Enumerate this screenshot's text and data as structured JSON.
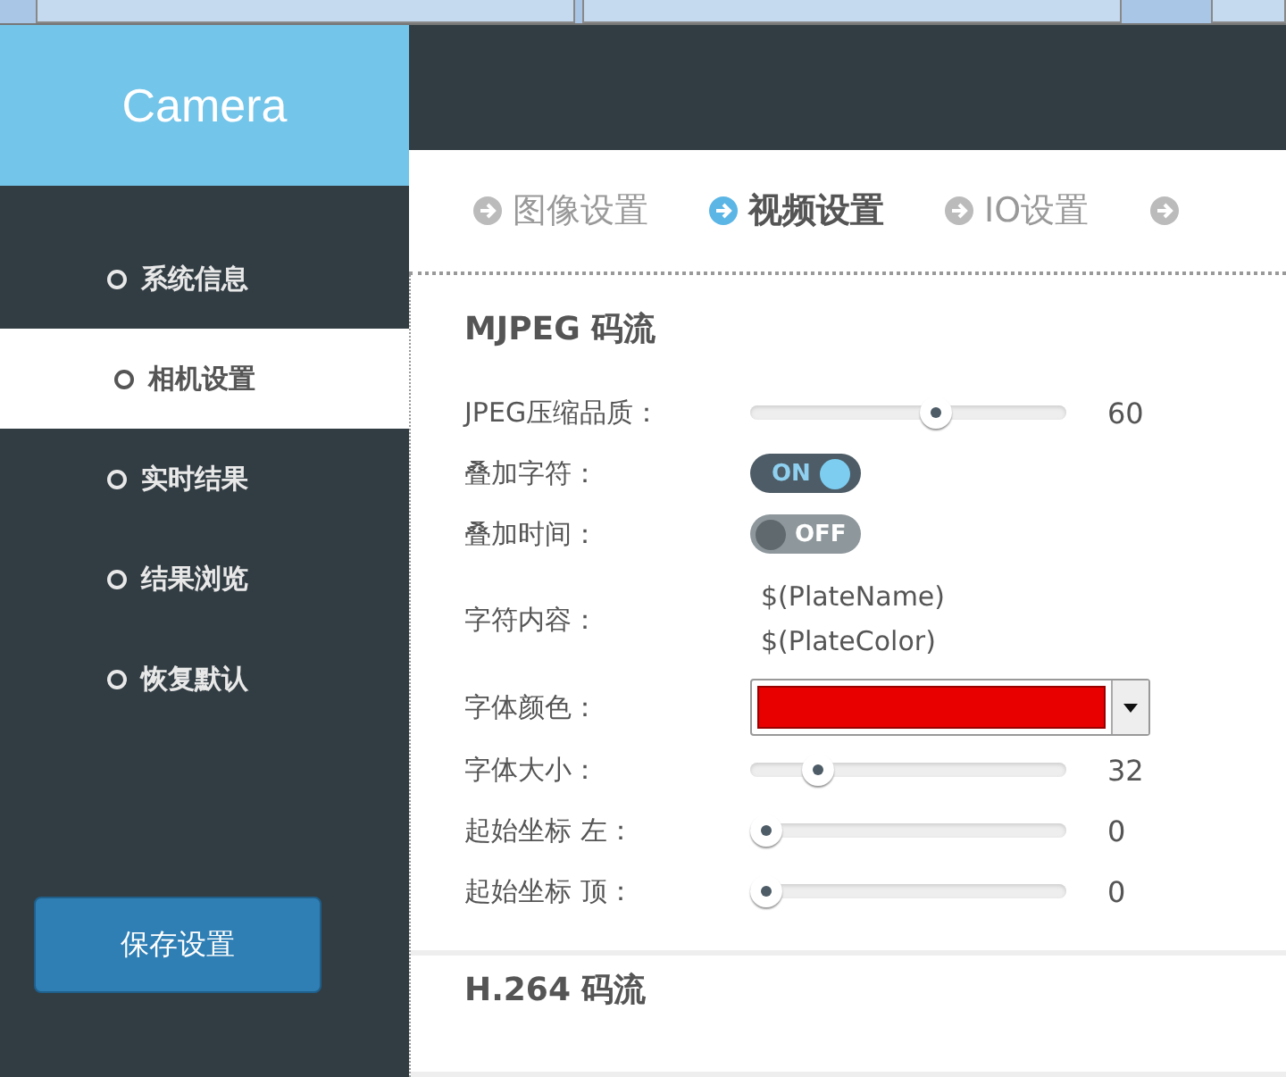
{
  "header": {
    "logo": "Camera"
  },
  "sidebar": {
    "items": [
      {
        "label": "系统信息",
        "selected": false
      },
      {
        "label": "相机设置",
        "selected": true
      },
      {
        "label": "实时结果",
        "selected": false
      },
      {
        "label": "结果浏览",
        "selected": false
      },
      {
        "label": "恢复默认",
        "selected": false
      }
    ],
    "save_button": "保存设置"
  },
  "tabs": [
    {
      "label": "图像设置",
      "selected": false
    },
    {
      "label": "视频设置",
      "selected": true
    },
    {
      "label": "IO设置",
      "selected": false
    }
  ],
  "sections": [
    {
      "title": "MJPEG 码流",
      "rows": [
        {
          "kind": "slider",
          "label": "JPEG压缩品质：",
          "level": 0.6,
          "reading": "60"
        },
        {
          "kind": "toggle",
          "label": "叠加字符：",
          "on": true,
          "text": "ON"
        },
        {
          "kind": "toggle",
          "label": "叠加时间：",
          "on": false,
          "text": "OFF"
        },
        {
          "kind": "text",
          "label": "字符内容：",
          "lines": [
            "$(PlateName)",
            "$(PlateColor)"
          ]
        },
        {
          "kind": "color",
          "label": "字体颜色：",
          "color": "#e80000"
        },
        {
          "kind": "slider",
          "label": "字体大小：",
          "level": 0.18,
          "reading": "32"
        },
        {
          "kind": "slider",
          "label": "起始坐标 左：",
          "level": 0,
          "reading": "0"
        },
        {
          "kind": "slider",
          "label": "起始坐标 顶：",
          "level": 0,
          "reading": "0"
        }
      ]
    },
    {
      "title": "H.264 码流"
    }
  ]
}
